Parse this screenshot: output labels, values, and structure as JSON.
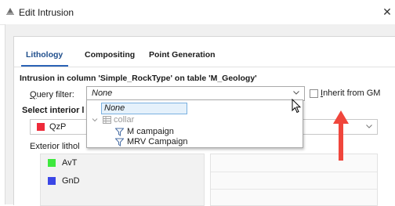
{
  "window": {
    "title": "Edit Intrusion",
    "close_glyph": "✕"
  },
  "tabs": [
    {
      "label": "Lithology",
      "active": true
    },
    {
      "label": "Compositing",
      "active": false
    },
    {
      "label": "Point Generation",
      "active": false
    }
  ],
  "section": {
    "title": "Intrusion in column 'Simple_RockType' on table 'M_Geology'"
  },
  "query_filter": {
    "label_first": "Q",
    "label_rest": "uery filter:",
    "value": "None",
    "inherit_label_first": "I",
    "inherit_label_rest": "nherit from GM",
    "inherit_checked": false
  },
  "interior": {
    "label": "Select interior l",
    "value": "QzP",
    "color": "#ee2b3a"
  },
  "exterior": {
    "label": "Exterior lithol",
    "items": [
      {
        "name": "AvT",
        "color": "#3ee83e"
      },
      {
        "name": "GnD",
        "color": "#3b47e6"
      }
    ]
  },
  "dropdown": {
    "selected": "None",
    "group": "collar",
    "filters": [
      "M campaign",
      "MRV Campaign"
    ]
  },
  "colors": {
    "annotation_arrow": "#f0463c",
    "tab_accent": "#2a63b6"
  }
}
